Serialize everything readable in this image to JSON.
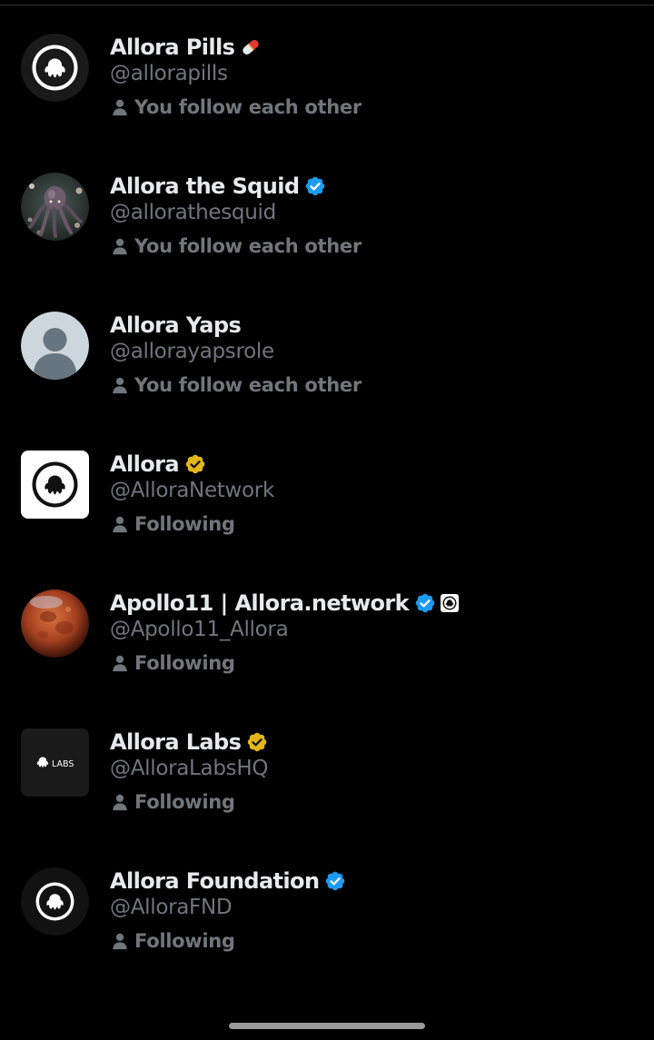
{
  "follow_list": [
    {
      "name": "Allora Pills",
      "handle": "@allorapills",
      "status": "You follow each other",
      "badge": "pill-emoji",
      "avatar": "allora-logo-round-dark"
    },
    {
      "name": "Allora the Squid",
      "handle": "@allorathesquid",
      "status": "You follow each other",
      "badge": "blue-verified",
      "avatar": "squid-photo"
    },
    {
      "name": "Allora Yaps",
      "handle": "@allorayapsrole",
      "status": "You follow each other",
      "badge": "none",
      "avatar": "default-profile"
    },
    {
      "name": "Allora",
      "handle": "@AlloraNetwork",
      "status": "Following",
      "badge": "gold-verified",
      "avatar": "allora-logo-white-square"
    },
    {
      "name": "Apollo11 | Allora.network",
      "handle": "@Apollo11_Allora",
      "status": "Following",
      "badge": "blue-verified",
      "affiliate_badge": "allora-affiliate",
      "avatar": "blood-moon-photo"
    },
    {
      "name": "Allora Labs",
      "handle": "@AlloraLabsHQ",
      "status": "Following",
      "badge": "gold-verified",
      "avatar": "allora-labs-logo",
      "avatar_text": "LABS"
    },
    {
      "name": "Allora Foundation",
      "handle": "@AlloraFND",
      "status": "Following",
      "badge": "blue-verified",
      "avatar": "allora-logo-round-dark"
    }
  ],
  "colors": {
    "background": "#000000",
    "primary_text": "#e7e9ea",
    "secondary_text": "#71767b",
    "verified_blue": "#1d9bf0",
    "verified_gold": "#e2b719"
  }
}
